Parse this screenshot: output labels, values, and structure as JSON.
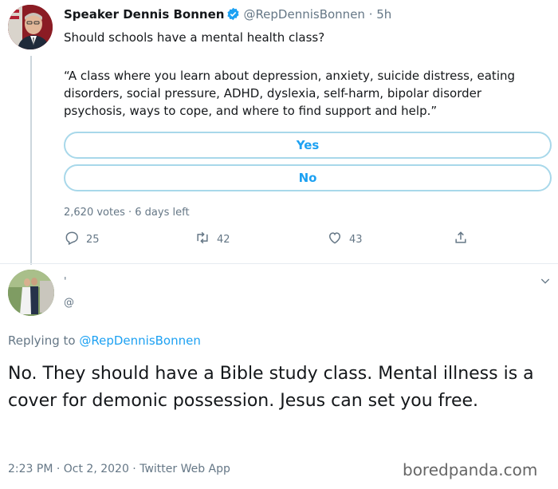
{
  "tweet": {
    "author_name": "Speaker Dennis Bonnen",
    "handle": "@RepDennisBonnen",
    "time": "· 5h",
    "text": "Should schools have a mental health class?",
    "quote": "“A class where you learn about depression, anxiety, suicide distress, eating disorders, social pressure, ADHD, dyslexia, self-harm, bipolar disorder psychosis, ways to cope, and where to find support and help.”",
    "poll": {
      "options": [
        "Yes",
        "No"
      ],
      "info": "2,620 votes · 6 days left"
    },
    "actions": {
      "replies": "25",
      "retweets": "42",
      "likes": "43"
    }
  },
  "reply": {
    "display_name": "'",
    "handle": "@",
    "replying_prefix": "Replying to",
    "replying_handle": "@RepDennisBonnen",
    "text": "No. They should have a Bible study class. Mental illness is a cover for demonic possession. Jesus can set you free.",
    "footer": "2:23 PM · Oct 2, 2020 · Twitter Web App"
  },
  "watermark": "boredpanda.com",
  "colors": {
    "accent": "#1da1f2",
    "secondary_text": "#657786",
    "poll_border": "#a8d8ea"
  },
  "icons": [
    "verified-badge-icon",
    "reply-icon",
    "retweet-icon",
    "like-icon",
    "share-icon",
    "chevron-down-icon"
  ]
}
